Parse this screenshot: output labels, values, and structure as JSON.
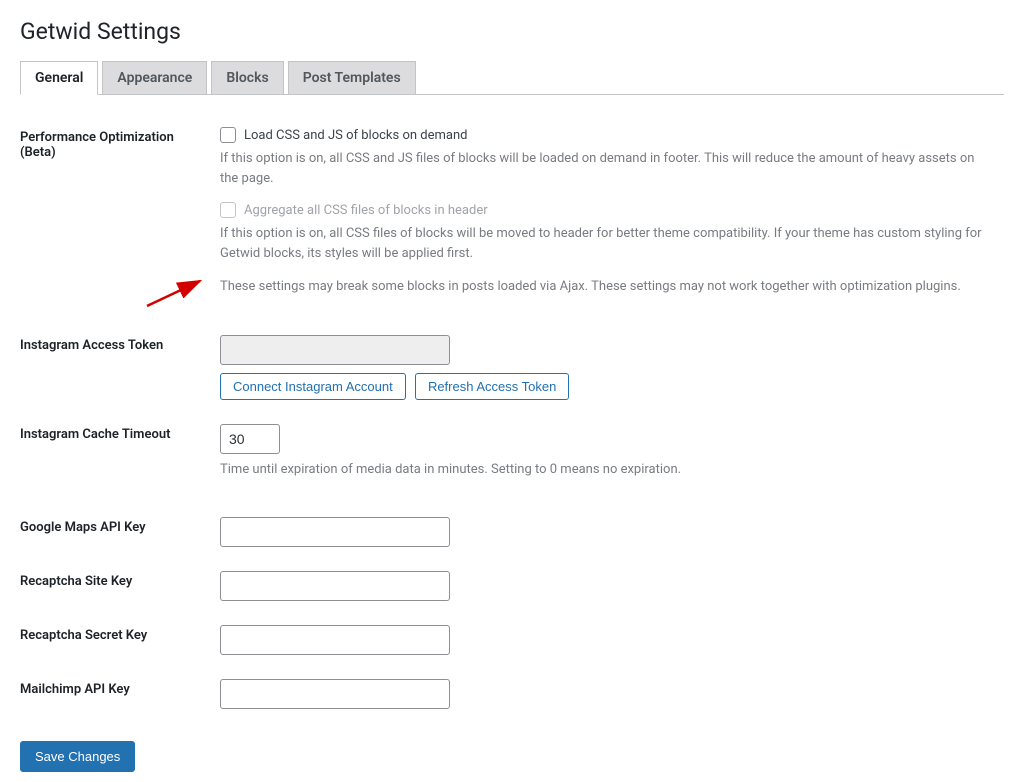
{
  "page": {
    "title": "Getwid Settings"
  },
  "tabs": {
    "general": "General",
    "appearance": "Appearance",
    "blocks": "Blocks",
    "post_templates": "Post Templates"
  },
  "performance": {
    "label": "Performance Optimization (Beta)",
    "load_on_demand": {
      "checkbox_label": "Load CSS and JS of blocks on demand",
      "description": "If this option is on, all CSS and JS files of blocks will be loaded on demand in footer. This will reduce the amount of heavy assets on the page."
    },
    "aggregate": {
      "checkbox_label": "Aggregate all CSS files of blocks in header",
      "description": "If this option is on, all CSS files of blocks will be moved to header for better theme compatibility. If your theme has custom styling for Getwid blocks, its styles will be applied first."
    },
    "note": "These settings may break some blocks in posts loaded via Ajax. These settings may not work together with optimization plugins."
  },
  "instagram_token": {
    "label": "Instagram Access Token",
    "value": "",
    "connect_button": "Connect Instagram Account",
    "refresh_button": "Refresh Access Token"
  },
  "instagram_cache": {
    "label": "Instagram Cache Timeout",
    "value": "30",
    "description": "Time until expiration of media data in minutes. Setting to 0 means no expiration."
  },
  "google_maps": {
    "label": "Google Maps API Key",
    "value": ""
  },
  "recaptcha_site": {
    "label": "Recaptcha Site Key",
    "value": ""
  },
  "recaptcha_secret": {
    "label": "Recaptcha Secret Key",
    "value": ""
  },
  "mailchimp": {
    "label": "Mailchimp API Key",
    "value": ""
  },
  "save_button": "Save Changes"
}
